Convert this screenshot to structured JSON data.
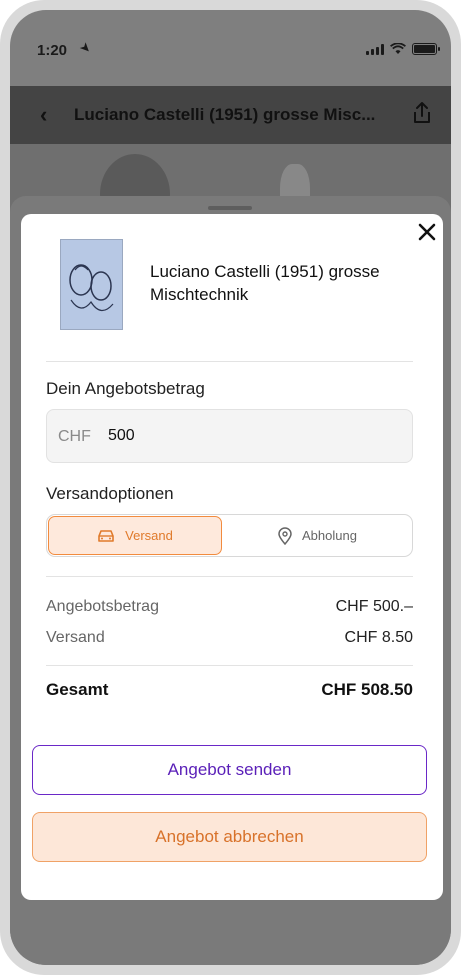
{
  "status_bar": {
    "time": "1:20",
    "location_icon": "location-arrow-icon",
    "signal_icon": "signal-icon",
    "wifi_icon": "wifi-icon",
    "battery_icon": "battery-icon"
  },
  "nav": {
    "back_icon": "chevron-left-icon",
    "title": "Luciano Castelli (1951) grosse Misc...",
    "share_icon": "share-icon"
  },
  "modal": {
    "close_icon": "close-icon",
    "product_title": "Luciano Castelli (1951) grosse Mischtechnik",
    "offer_label": "Dein Angebotsbetrag",
    "currency": "CHF",
    "amount": "500",
    "shipping_label": "Versandoptionen",
    "shipping_options": [
      {
        "label": "Versand",
        "icon": "car-icon",
        "selected": true
      },
      {
        "label": "Abholung",
        "icon": "location-pin-icon",
        "selected": false
      }
    ],
    "summary": {
      "offer_amount_label": "Angebotsbetrag",
      "offer_amount_value": "CHF 500.–",
      "shipping_label": "Versand",
      "shipping_value": "CHF 8.50",
      "total_label": "Gesamt",
      "total_value": "CHF 508.50"
    },
    "send_button": "Angebot senden",
    "cancel_button": "Angebot abbrechen"
  },
  "colors": {
    "accent_orange": "#f28b3e",
    "accent_orange_bg": "#fee9dc",
    "accent_purple": "#6a28c7"
  }
}
